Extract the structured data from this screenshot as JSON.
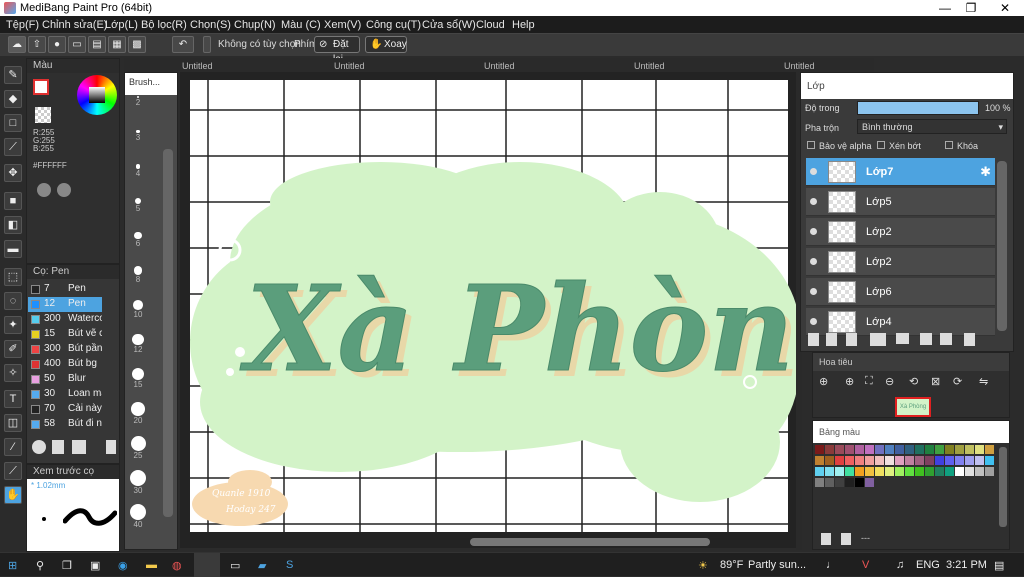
{
  "window": {
    "title": "MediBang Paint Pro (64bit)",
    "min": "—",
    "max": "❐",
    "close": "✕"
  },
  "menu": [
    "Tệp(F)",
    "Chỉnh sửa(E)",
    "Lớp(L)",
    "Bộ lọc(R)",
    "Chọn(S)",
    "Chụp(N)",
    "Màu (C)",
    "Xem(V)",
    "Công cụ(T)",
    "Cửa sổ(W)",
    "Cloud",
    "Help"
  ],
  "toolbar": {
    "sym_label": "Không có tùy chọn",
    "keys_label": "Phím",
    "reset_label": "Đặt lại",
    "rotate_label": "Xoay"
  },
  "tabs": [
    "Untitled",
    "Untitled",
    "Untitled",
    "Untitled",
    "Untitled"
  ],
  "color_panel": {
    "title": "Màu",
    "r": "R:255",
    "g": "G:255",
    "b": "B:255",
    "hex": "#FFFFFF"
  },
  "brush_panel": {
    "title": "Cọ: Pen",
    "items": [
      {
        "size": "7",
        "name": "Pen",
        "color": "#222222"
      },
      {
        "size": "12",
        "name": "Pen",
        "color": "#1e90ff"
      },
      {
        "size": "300",
        "name": "Waterco",
        "color": "#55ccee"
      },
      {
        "size": "15",
        "name": "Bút vẽ c",
        "color": "#e8d020"
      },
      {
        "size": "300",
        "name": "Bút pần",
        "color": "#ee4444"
      },
      {
        "size": "400",
        "name": "Bút bg",
        "color": "#dd3333"
      },
      {
        "size": "50",
        "name": "Blur",
        "color": "#e8a0e0"
      },
      {
        "size": "30",
        "name": "Loan mà",
        "color": "#55aaee"
      },
      {
        "size": "70",
        "name": "Cải này c",
        "color": "#222222"
      },
      {
        "size": "58",
        "name": "Bút đi n",
        "color": "#55aaee"
      }
    ]
  },
  "brush_sizes": {
    "header": "Brush...",
    "sizes": [
      "2",
      "3",
      "4",
      "5",
      "6",
      "8",
      "10",
      "12",
      "15",
      "20",
      "25",
      "30",
      "40"
    ]
  },
  "preview_panel": {
    "title": "Xem trước cọ",
    "size": "* 1.02mm"
  },
  "layers_panel": {
    "title": "Lớp",
    "opacity_label": "Độ trong",
    "opacity_value": "100 %",
    "opacity": 1.0,
    "blend_label": "Pha trộn",
    "blend_value": "Bình thường",
    "protect_alpha": "Bảo vệ alpha",
    "clip": "Xén bớt",
    "lock": "Khóa",
    "layers": [
      "Lớp7",
      "Lớp5",
      "Lớp2",
      "Lớp2",
      "Lớp6",
      "Lớp4"
    ],
    "selected": 0
  },
  "navigator": {
    "title": "Hoa tiêu",
    "thumb_text": "Xà Phòng"
  },
  "palette": {
    "title": "Bảng màu",
    "footer": "---"
  },
  "canvas": {
    "main_text": "Xà Phòng",
    "signature_line1": "Quanle 1910",
    "signature_line2": "Hoday 247"
  },
  "taskbar": {
    "weather_temp": "89°F",
    "weather_desc": "Partly sun...",
    "lang": "ENG",
    "time": "3:21 PM"
  },
  "colors": {
    "bg": "#2b2b2b",
    "accent": "#4da3e0",
    "cloud": "#d3f3c8",
    "letter": "#5b9e7c",
    "shadow": "#e8d8a8",
    "grid": "#222222"
  }
}
